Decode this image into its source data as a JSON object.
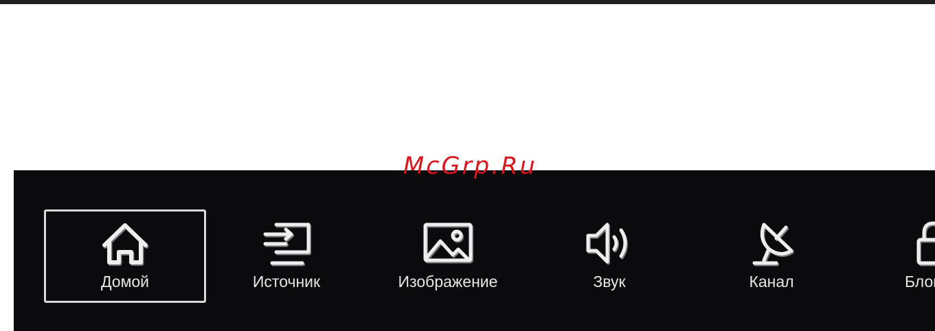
{
  "watermark": "McGrp.Ru",
  "menu": {
    "items": [
      {
        "label": "Домой",
        "icon": "home-icon",
        "selected": true
      },
      {
        "label": "Источник",
        "icon": "input-source-icon",
        "selected": false
      },
      {
        "label": "Изображение",
        "icon": "picture-icon",
        "selected": false
      },
      {
        "label": "Звук",
        "icon": "speaker-icon",
        "selected": false
      },
      {
        "label": "Канал",
        "icon": "satellite-dish-icon",
        "selected": false
      },
      {
        "label": "Блок си",
        "icon": "lock-icon",
        "selected": false
      }
    ]
  },
  "colors": {
    "menu_background": "#0b0b0d",
    "icon_stroke": "#e6e6e6",
    "icon_shadow": "#7a7a7a",
    "watermark": "#d8161d"
  }
}
